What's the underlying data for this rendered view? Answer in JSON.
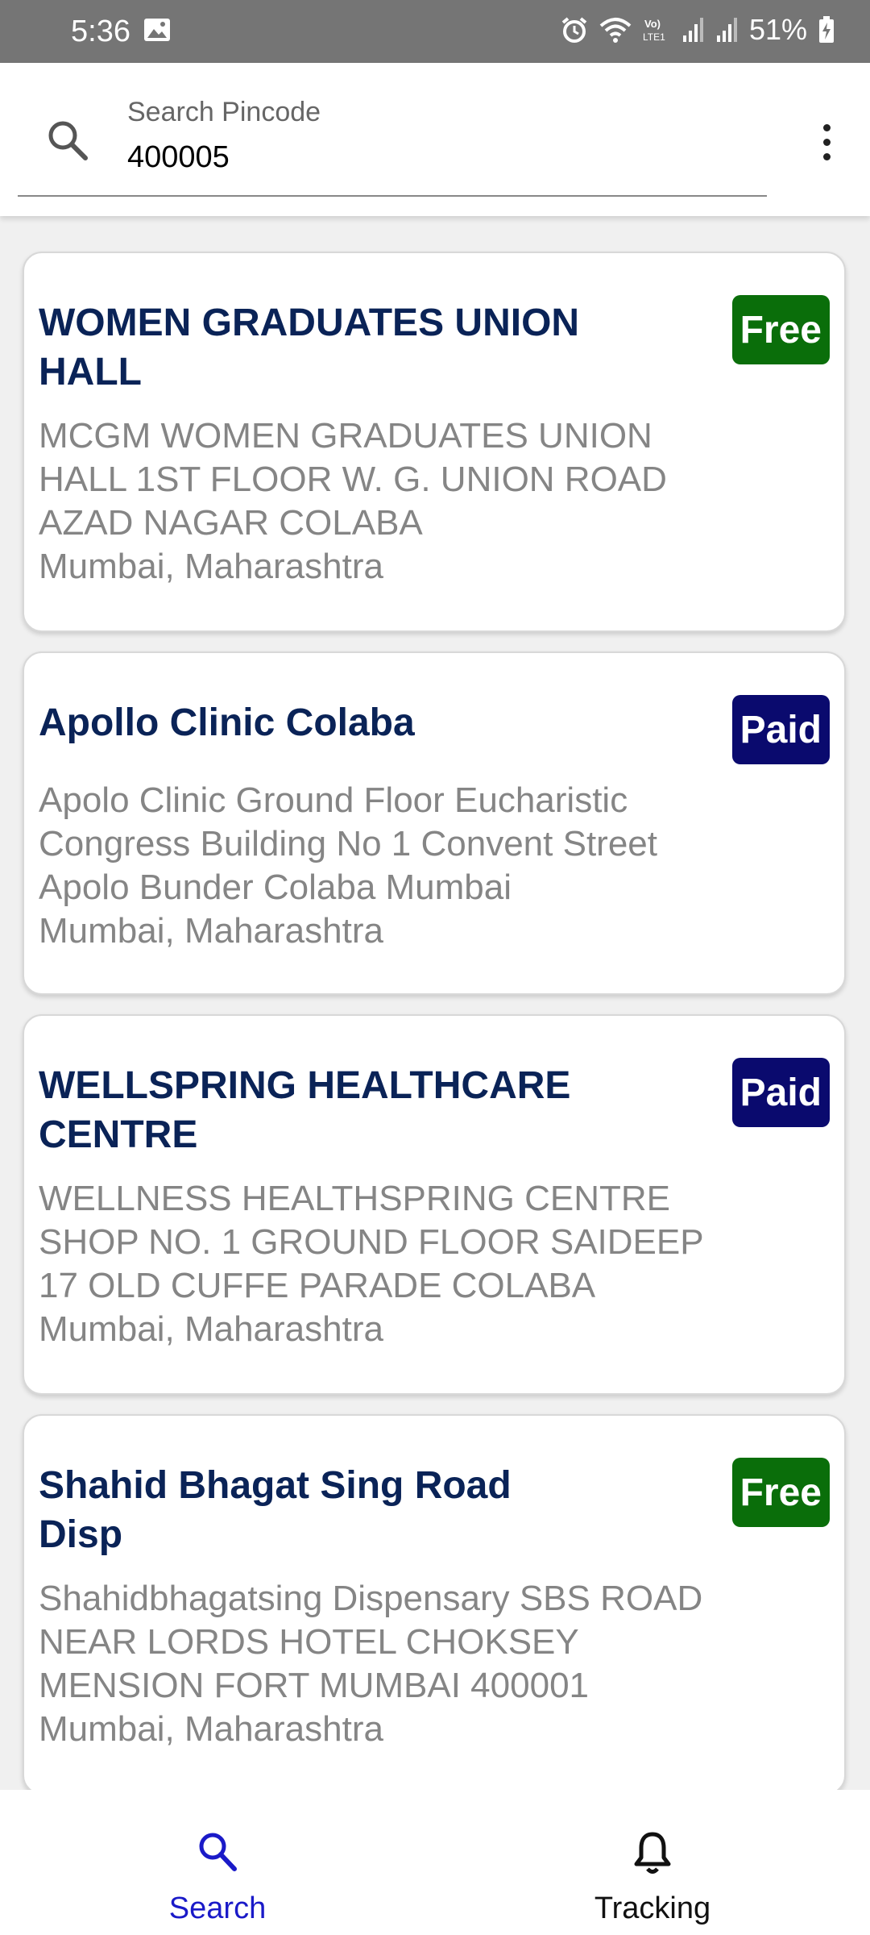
{
  "status_bar": {
    "time": "5:36",
    "battery": "51%",
    "icons": [
      "gallery-icon",
      "alarm-icon",
      "wifi-icon",
      "volte-icon",
      "signal-icon",
      "signal-icon",
      "battery-charging-icon"
    ]
  },
  "search": {
    "label": "Search Pincode",
    "value": "400005",
    "icon": "search-icon",
    "menu_icon": "more-vert-icon"
  },
  "colors": {
    "title": "#0a2357",
    "free_badge": "#0a6e0a",
    "paid_badge": "#0a0a6e",
    "nav_active": "#1a1ac8",
    "nav_inactive": "#111111"
  },
  "centres": [
    {
      "name": "WOMEN GRADUATES UNION HALL",
      "type": "Free",
      "address": "MCGM WOMEN GRADUATES UNION HALL 1ST FLOOR W. G. UNION ROAD AZAD NAGAR COLABA",
      "city": "Mumbai, Maharashtra"
    },
    {
      "name": "Apollo Clinic Colaba",
      "type": "Paid",
      "address": "Apolo Clinic Ground Floor Eucharistic Congress Building No 1 Convent Street Apolo Bunder Colaba Mumbai",
      "city": "Mumbai, Maharashtra"
    },
    {
      "name": "WELLSPRING HEALTHCARE CENTRE",
      "type": "Paid",
      "address": "WELLNESS HEALTHSPRING CENTRE SHOP NO. 1 GROUND FLOOR SAIDEEP 17 OLD CUFFE PARADE COLABA",
      "city": "Mumbai, Maharashtra"
    },
    {
      "name": "Shahid Bhagat Sing Road Disp",
      "type": "Free",
      "address": "Shahidbhagatsing Dispensary SBS ROAD NEAR LORDS HOTEL CHOKSEY MENSION FORT MUMBAI 400001",
      "city": "Mumbai, Maharashtra"
    }
  ],
  "bottom_nav": [
    {
      "label": "Search",
      "icon": "search-icon",
      "active": true
    },
    {
      "label": "Tracking",
      "icon": "bell-icon",
      "active": false
    }
  ]
}
